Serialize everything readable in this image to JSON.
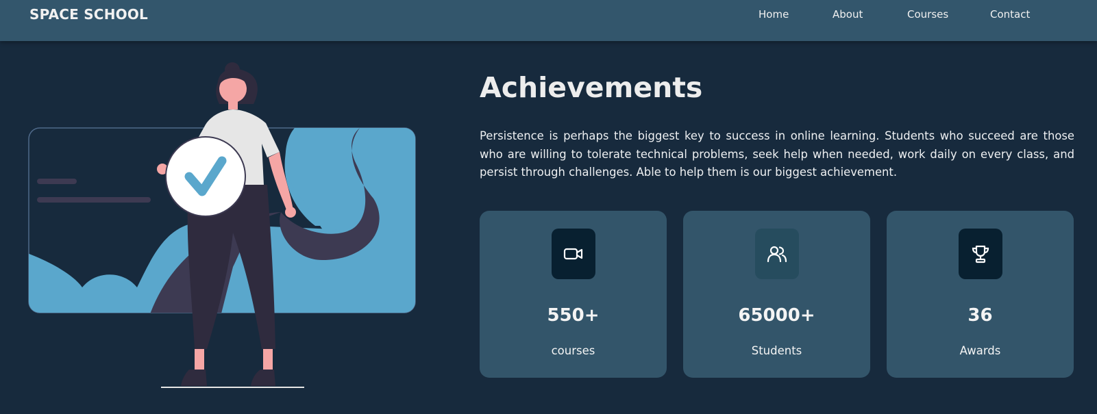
{
  "header": {
    "brand": "SPACE SCHOOL",
    "nav": [
      "Home",
      "About",
      "Courses",
      "Contact"
    ]
  },
  "achievements": {
    "title": "Achievements",
    "description": "Persistence is perhaps the biggest key to success in online learning. Students who succeed are those who are willing to tolerate technical problems, seek help when needed, work daily on every class, and persist through challenges. Able to help them is our biggest achievement.",
    "stats": [
      {
        "icon": "video-camera-icon",
        "value": "550+",
        "label": "courses"
      },
      {
        "icon": "users-icon",
        "value": "65000+",
        "label": "Students"
      },
      {
        "icon": "trophy-icon",
        "value": "36",
        "label": "Awards"
      }
    ]
  },
  "colors": {
    "background": "#172a3d",
    "navbar": "#33566c",
    "card": "#33556a",
    "accent_blue": "#5aa7cc",
    "figure_dark": "#2f2b3e",
    "skin": "#f5a6a5"
  }
}
